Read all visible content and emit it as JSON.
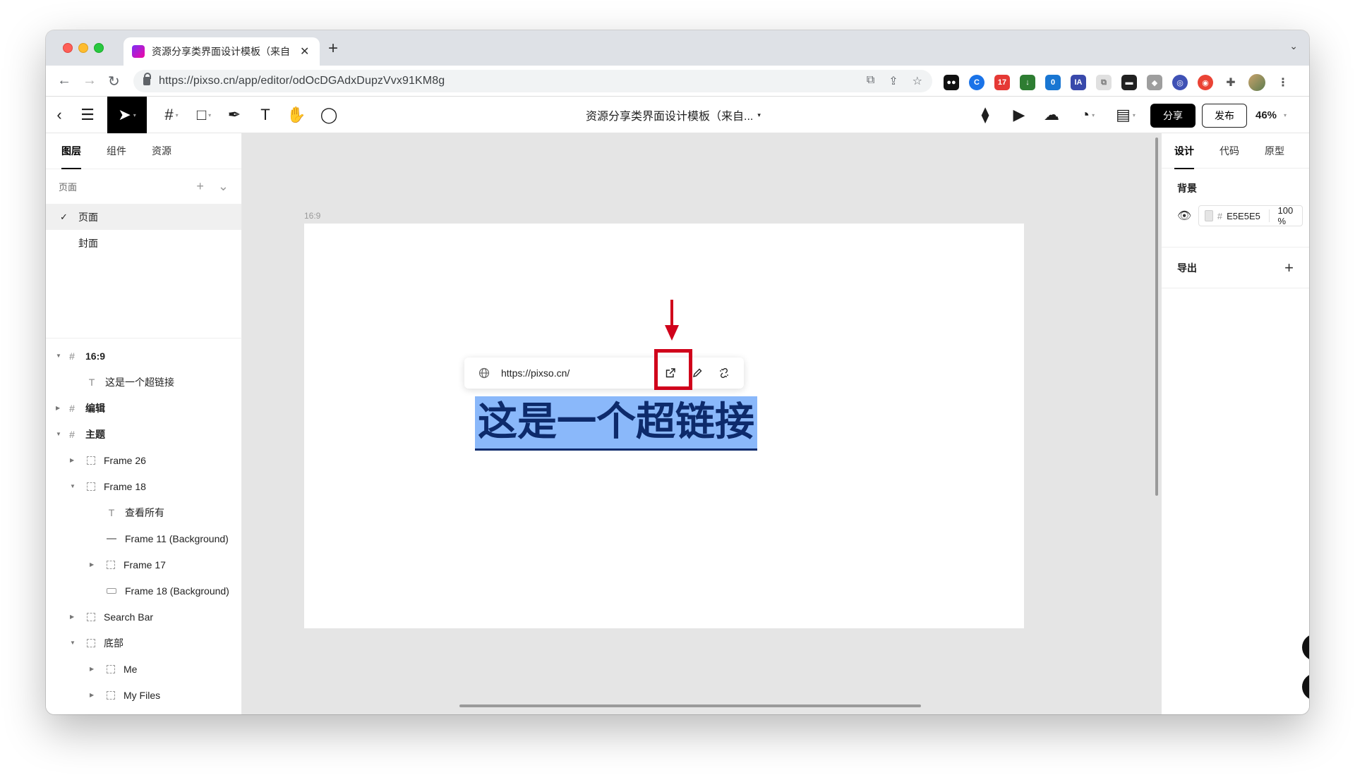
{
  "browser": {
    "tab_title": "资源分享类界面设计模板（来自",
    "tab_close": "✕",
    "new_tab": "+",
    "url": "https://pixso.cn/app/editor/odOcDGAdxDupzVvx91KM8g",
    "extension_badge_1": "17",
    "extension_badge_2": "0",
    "extension_ia": "IA"
  },
  "app_toolbar": {
    "doc_title": "资源分享类界面设计模板（来自...",
    "share_label": "分享",
    "publish_label": "发布",
    "zoom": "46%"
  },
  "left_panel": {
    "tabs": [
      "图层",
      "组件",
      "资源"
    ],
    "pages_header": "页面",
    "pages": [
      "页面",
      "封面"
    ],
    "layers": [
      {
        "name": "16:9",
        "bold": true
      },
      {
        "name": "这是一个超链接"
      },
      {
        "name": "编辑",
        "bold": true
      },
      {
        "name": "主题",
        "bold": true
      },
      {
        "name": "Frame 26"
      },
      {
        "name": "Frame 18"
      },
      {
        "name": "查看所有"
      },
      {
        "name": "Frame 11 (Background)"
      },
      {
        "name": "Frame 17"
      },
      {
        "name": "Frame 18 (Background)"
      },
      {
        "name": "Search Bar"
      },
      {
        "name": "底部"
      },
      {
        "name": "Me"
      },
      {
        "name": "My Files"
      }
    ]
  },
  "canvas": {
    "frame_label": "16:9",
    "link_url": "https://pixso.cn/",
    "hyperlink_text": "这是一个超链接"
  },
  "right_panel": {
    "tabs": [
      "设计",
      "代码",
      "原型"
    ],
    "background_title": "背景",
    "bg_hex": "E5E5E5",
    "bg_opacity": "100 %",
    "export_title": "导出"
  },
  "colors": {
    "accent_red": "#d0021b",
    "selection_blue": "#8ab8fa",
    "canvas_bg": "#e5e5e5"
  }
}
